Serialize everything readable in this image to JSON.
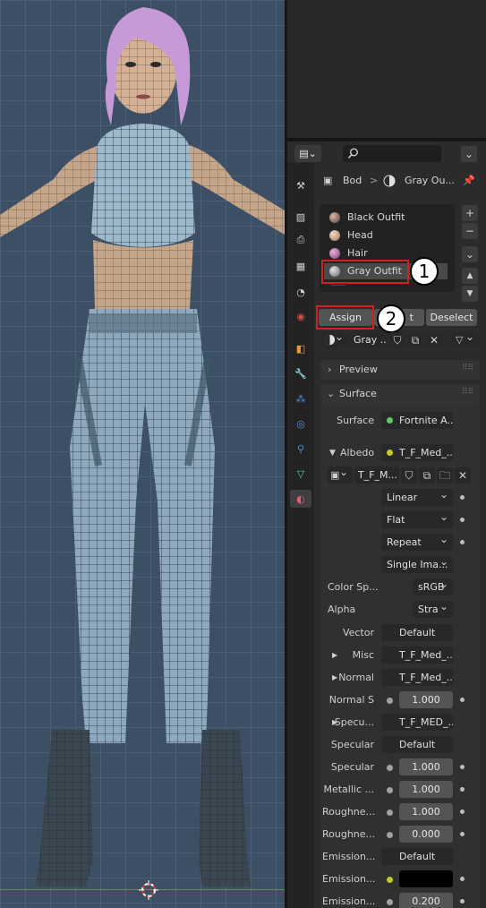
{
  "header": {
    "search_placeholder": "",
    "breadcrumb_object": "Bod",
    "breadcrumb_separator": ">",
    "breadcrumb_material": "Gray Ou..."
  },
  "material_slots": [
    {
      "label": "Black Outfit",
      "color": "#8a6a5a"
    },
    {
      "label": "Head",
      "color": "#e0b89a"
    },
    {
      "label": "Hair",
      "color": "#c27ab4"
    },
    {
      "label": "Gray Outfit",
      "color": "#a8a8a8"
    }
  ],
  "slot_side_buttons": {
    "add": "+",
    "remove": "−",
    "menu": "⌄",
    "up": "▲",
    "down": "▼"
  },
  "edit_buttons": {
    "assign": "Assign",
    "select": "t",
    "deselect": "Deselect"
  },
  "material_selector": {
    "name": "Gray ..."
  },
  "panels": {
    "preview": "Preview",
    "surface": "Surface"
  },
  "surface_rows": [
    {
      "label": "Surface",
      "value": "Fortnite A...",
      "socket": "g"
    },
    {
      "label": "Albedo",
      "value": "T_F_Med_...",
      "socket": "y"
    }
  ],
  "image_block": {
    "image_name": "T_F_M...",
    "interpolation": "Linear",
    "projection": "Flat",
    "extension": "Repeat",
    "source": "Single Ima...",
    "color_space_label": "Color Sp...",
    "color_space_value": "sRGB",
    "alpha_label": "Alpha",
    "alpha_value": "Stra"
  },
  "input_rows": [
    {
      "label": "Vector",
      "value": "Default",
      "kind": "link",
      "socket": "b",
      "arrow": false
    },
    {
      "label": "Misc",
      "value": "T_F_Med_...",
      "kind": "link",
      "socket": "y",
      "arrow": true
    },
    {
      "label": "Normal",
      "value": "T_F_Med_...",
      "kind": "link",
      "socket": "y",
      "arrow": true
    },
    {
      "label": "Normal S",
      "value": "1.000",
      "kind": "num",
      "socket": "gr",
      "arrow": false
    },
    {
      "label": "Specu...",
      "value": "T_F_MED_...",
      "kind": "link",
      "socket": "y",
      "arrow": true
    },
    {
      "label": "Specular",
      "value": "Default",
      "kind": "link",
      "socket": "b",
      "arrow": false
    },
    {
      "label": "Specular",
      "value": "1.000",
      "kind": "num",
      "socket": "gr",
      "arrow": false
    },
    {
      "label": "Metallic ...",
      "value": "1.000",
      "kind": "num",
      "socket": "gr",
      "arrow": false
    },
    {
      "label": "Roughne...",
      "value": "1.000",
      "kind": "num",
      "socket": "gr",
      "arrow": false
    },
    {
      "label": "Roughne...",
      "value": "0.000",
      "kind": "num",
      "socket": "gr",
      "arrow": false
    },
    {
      "label": "Emission...",
      "value": "Default",
      "kind": "link",
      "socket": "b",
      "arrow": false
    },
    {
      "label": "Emission...",
      "value": "",
      "kind": "color",
      "socket": "y",
      "arrow": false
    },
    {
      "label": "Emission...",
      "value": "0.200",
      "kind": "num",
      "socket": "gr",
      "arrow": false
    }
  ],
  "callouts": [
    "1",
    "2"
  ],
  "colors": {
    "highlight": "#d42020",
    "accent": "#4772b3"
  }
}
